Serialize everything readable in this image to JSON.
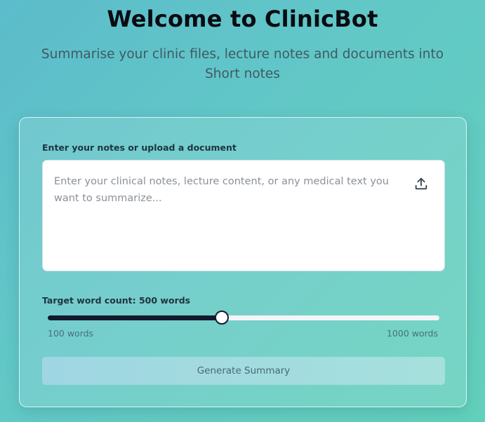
{
  "header": {
    "title": "Welcome to ClinicBot",
    "subtitle": "Summarise your clinic files, lecture notes and documents into Short notes"
  },
  "form": {
    "notes_label": "Enter your notes or upload a document",
    "notes_value": "",
    "notes_placeholder": "Enter your clinical notes, lecture content, or any medical text you want to summarize...",
    "upload_icon": "upload-icon",
    "word_count_label": "Target word count: 500 words",
    "slider": {
      "min_label": "100 words",
      "max_label": "1000 words",
      "min": 100,
      "max": 1000,
      "value": 500
    },
    "generate_label": "Generate Summary"
  },
  "colors": {
    "background_start": "#5cbccb",
    "background_end": "#62d0bb",
    "slider_fill": "#121a2e",
    "button_bg": "#a6dce0"
  }
}
